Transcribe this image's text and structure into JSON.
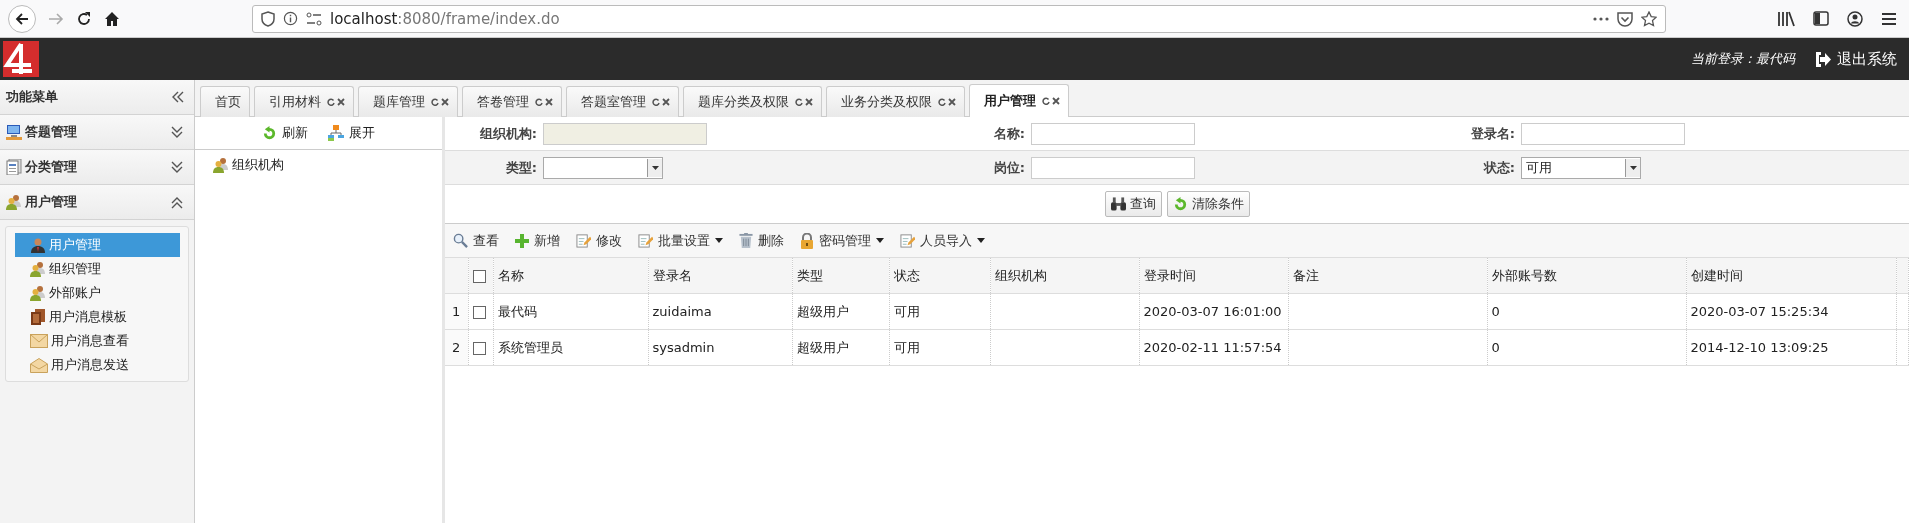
{
  "browser": {
    "host": "localhost",
    "path": ":8080/frame/index.do"
  },
  "header": {
    "current_user": "当前登录：最代码",
    "logout": "退出系统"
  },
  "sidebar": {
    "title": "功能菜单",
    "groups": [
      {
        "label": "答题管理",
        "expanded": false
      },
      {
        "label": "分类管理",
        "expanded": false
      },
      {
        "label": "用户管理",
        "expanded": true,
        "items": [
          {
            "label": "用户管理",
            "selected": true
          },
          {
            "label": "组织管理",
            "selected": false
          },
          {
            "label": "外部账户",
            "selected": false
          },
          {
            "label": "用户消息模板",
            "selected": false
          },
          {
            "label": "用户消息查看",
            "selected": false
          },
          {
            "label": "用户消息发送",
            "selected": false
          }
        ]
      }
    ]
  },
  "tabs": [
    {
      "label": "首页",
      "closable": false,
      "selected": false
    },
    {
      "label": "引用材料",
      "closable": true,
      "selected": false
    },
    {
      "label": "题库管理",
      "closable": true,
      "selected": false
    },
    {
      "label": "答卷管理",
      "closable": true,
      "selected": false
    },
    {
      "label": "答题室管理",
      "closable": true,
      "selected": false
    },
    {
      "label": "题库分类及权限",
      "closable": true,
      "selected": false
    },
    {
      "label": "业务分类及权限",
      "closable": true,
      "selected": false
    },
    {
      "label": "用户管理",
      "closable": true,
      "selected": true
    }
  ],
  "tree": {
    "toolbar": [
      "刷新",
      "展开"
    ],
    "nodes": [
      {
        "label": "组织机构"
      }
    ]
  },
  "search": {
    "fields": [
      {
        "label": "组织机构:",
        "kind": "readonly"
      },
      {
        "label": "名称:",
        "kind": "text"
      },
      {
        "label": "登录名:",
        "kind": "text"
      },
      {
        "label": "类型:",
        "kind": "select"
      },
      {
        "label": "岗位:",
        "kind": "text"
      },
      {
        "label": "状态:",
        "kind": "select",
        "value": "可用"
      }
    ],
    "buttons": [
      "查询",
      "清除条件"
    ]
  },
  "toolbar": [
    {
      "label": "查看",
      "dropdown": false
    },
    {
      "label": "新增",
      "dropdown": false
    },
    {
      "label": "修改",
      "dropdown": false
    },
    {
      "label": "批量设置",
      "dropdown": true
    },
    {
      "label": "删除",
      "dropdown": false
    },
    {
      "label": "密码管理",
      "dropdown": true
    },
    {
      "label": "人员导入",
      "dropdown": true
    }
  ],
  "table": {
    "all_checked": false,
    "columns": [
      "名称",
      "登录名",
      "类型",
      "状态",
      "组织机构",
      "登录时间",
      "备注",
      "外部账号数",
      "创建时间"
    ],
    "rows": [
      {
        "number": "1",
        "checked": false,
        "cells": [
          "最代码",
          "zuidaima",
          "超级用户",
          "可用",
          null,
          "2020-03-07 16:01:00",
          null,
          "0",
          "2020-03-07 15:25:34"
        ]
      },
      {
        "number": "2",
        "checked": false,
        "cells": [
          "系统管理员",
          "sysadmin",
          "超级用户",
          "可用",
          null,
          "2020-02-11 11:57:54",
          null,
          "0",
          "2014-12-10 13:09:25"
        ]
      }
    ]
  }
}
